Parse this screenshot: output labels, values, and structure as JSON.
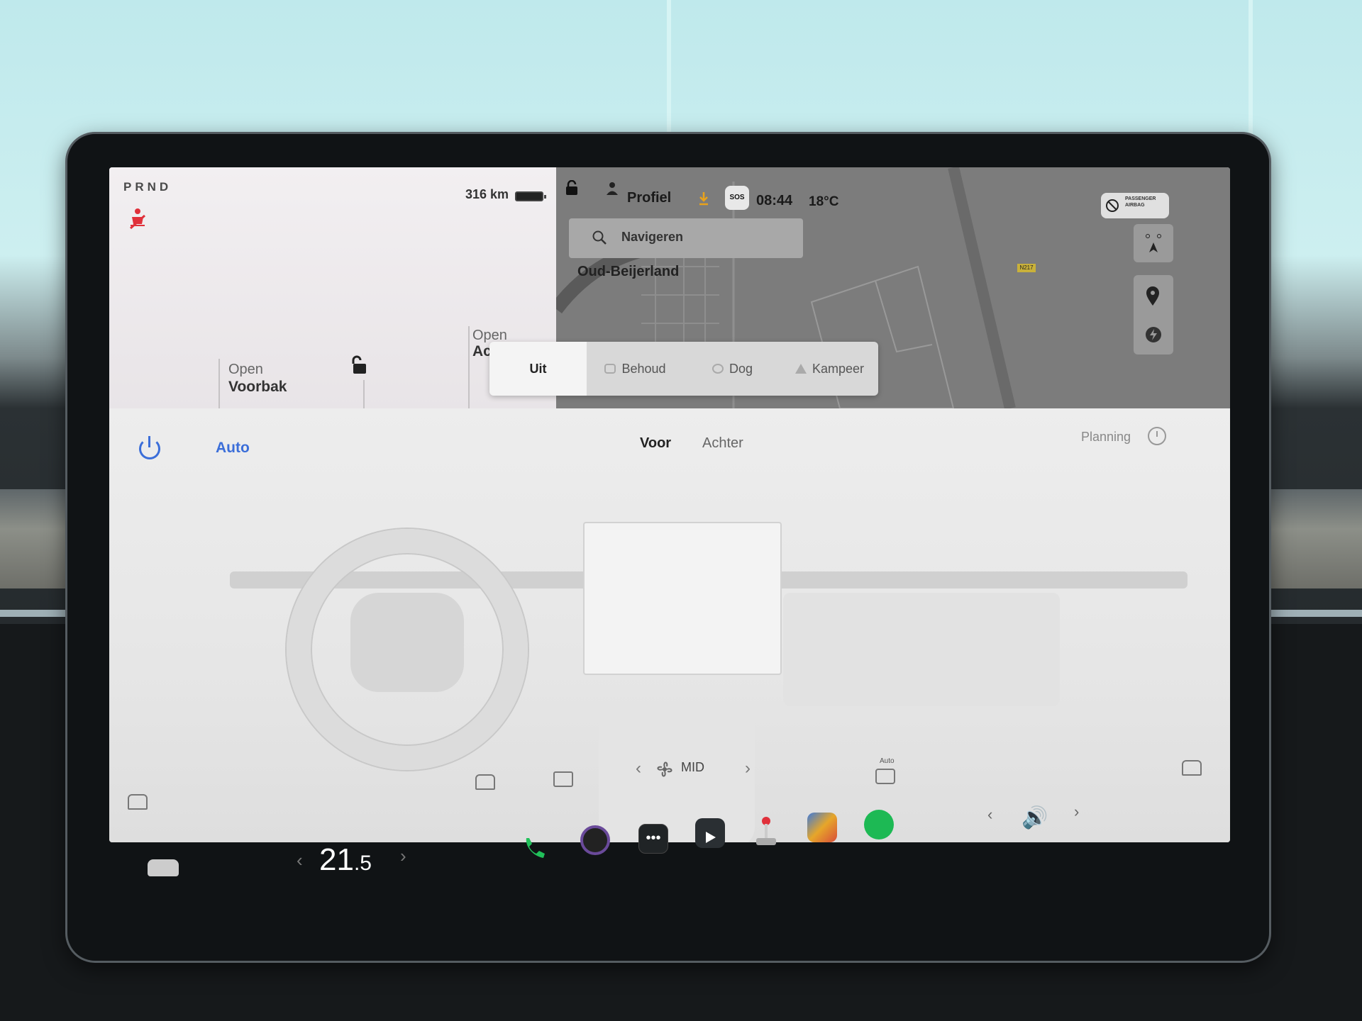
{
  "status": {
    "gear": "PRND",
    "range": "316 km",
    "profile": "Profiel",
    "time": "08:44",
    "outside_temp": "18°C",
    "sos": "SOS",
    "airbag": "PASSENGER AIRBAG"
  },
  "car_panel": {
    "front_trunk_label": "Open",
    "front_trunk_value": "Voorbak",
    "rear_trunk_label": "Open",
    "rear_trunk_value": "Ac"
  },
  "map": {
    "search_placeholder": "Navigeren",
    "city": "Oud-Beijerland",
    "road_tag": "N217"
  },
  "climate_modes": [
    {
      "label": "Uit",
      "active": true
    },
    {
      "label": "Behoud",
      "active": false
    },
    {
      "label": "Dog",
      "active": false
    },
    {
      "label": "Kampeer",
      "active": false
    }
  ],
  "climate": {
    "auto_label": "Auto",
    "tab_front": "Voor",
    "tab_rear": "Achter",
    "planning": "Planning",
    "fan_mode": "MID",
    "recirc_auto": "Auto"
  },
  "taskbar": {
    "temp_main": "21",
    "temp_decimal": ".5"
  },
  "colors": {
    "accent": "#3b6ed9",
    "warning": "#e0303a",
    "download": "#e9a21a",
    "spotify": "#1db954",
    "phone": "#21c05a"
  }
}
